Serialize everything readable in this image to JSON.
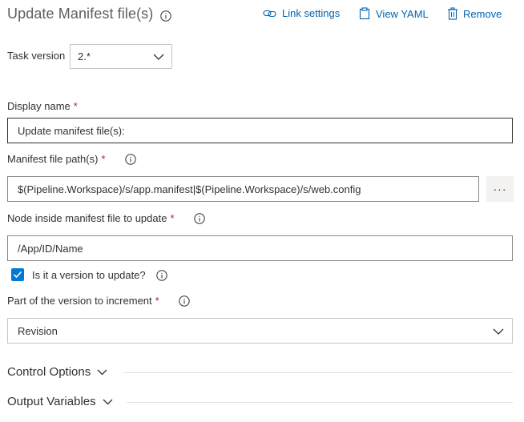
{
  "header": {
    "title": "Update Manifest file(s)",
    "link_settings_label": "Link settings",
    "view_yaml_label": "View YAML",
    "remove_label": "Remove"
  },
  "task_version": {
    "label": "Task version",
    "value": "2.*"
  },
  "display_name": {
    "label": "Display name",
    "required_mark": "*",
    "value": "Update manifest file(s):"
  },
  "manifest_path": {
    "label": "Manifest file path(s)",
    "required_mark": "*",
    "value": "$(Pipeline.Workspace)/s/app.manifest|$(Pipeline.Workspace)/s/web.config",
    "browse_label": "···"
  },
  "node": {
    "label": "Node inside manifest file to update",
    "required_mark": "*",
    "value": "/App/ID/Name"
  },
  "is_version": {
    "label": "Is it a version to update?",
    "checked": true
  },
  "version_part": {
    "label": "Part of the version to increment",
    "required_mark": "*",
    "value": "Revision"
  },
  "sections": {
    "control_options": "Control Options",
    "output_variables": "Output Variables"
  },
  "colors": {
    "accent": "#0078d4",
    "link": "#0063b1",
    "required": "#a4262c"
  }
}
